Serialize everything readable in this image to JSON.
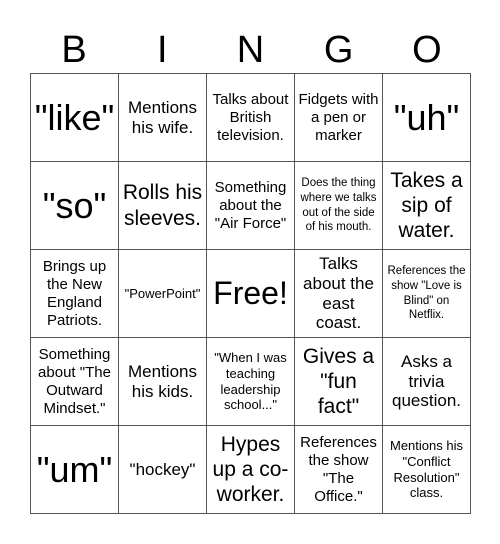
{
  "header": {
    "letters": [
      "B",
      "I",
      "N",
      "G",
      "O"
    ]
  },
  "cells": [
    [
      "\"like\"",
      "Mentions his wife.",
      "Talks about British television.",
      "Fidgets with a pen or marker",
      "\"uh\""
    ],
    [
      "\"so\"",
      "Rolls his sleeves.",
      "Something about the \"Air Force\"",
      "Does the thing where we talks out of the side of his mouth.",
      "Takes a sip of water."
    ],
    [
      "Brings up the New England Patriots.",
      "\"PowerPoint\"",
      "Free!",
      "Talks about the east coast.",
      "References the show \"Love is Blind\" on Netflix."
    ],
    [
      "Something about \"The Outward Mindset.\"",
      "Mentions his kids.",
      "\"When I was teaching leadership school...\"",
      "Gives a \"fun fact\"",
      "Asks a trivia question."
    ],
    [
      "\"um\"",
      "\"hockey\"",
      "Hypes up a co-worker.",
      "References the show \"The Office.\"",
      "Mentions his \"Conflict Resolution\" class."
    ]
  ]
}
